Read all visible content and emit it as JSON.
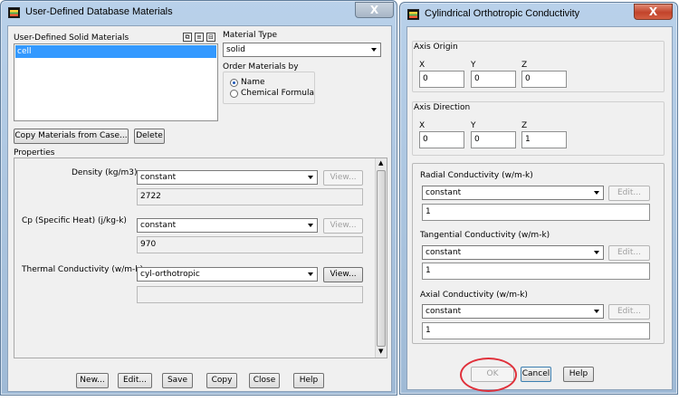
{
  "materials_window": {
    "title": "User-Defined Database Materials",
    "solid_materials_label": "User-Defined Solid Materials",
    "materials": [
      "cell"
    ],
    "copy_button": "Copy Materials from Case...",
    "delete_button": "Delete",
    "material_type_label": "Material Type",
    "material_type_value": "solid",
    "order_label": "Order Materials by",
    "order_options": [
      "Name",
      "Chemical Formula"
    ],
    "order_selected": "Name",
    "properties_label": "Properties",
    "properties": [
      {
        "label": "Density (kg/m3)",
        "method": "constant",
        "view": "View...",
        "value": "2722"
      },
      {
        "label": "Cp (Specific Heat) (j/kg-k)",
        "method": "constant",
        "view": "View...",
        "value": "970"
      },
      {
        "label": "Thermal Conductivity (w/m-k)",
        "method": "cyl-orthotropic",
        "view": "View...",
        "value": ""
      }
    ],
    "footer_buttons": [
      "New...",
      "Edit...",
      "Save",
      "Copy",
      "Close",
      "Help"
    ]
  },
  "conductivity_window": {
    "title": "Cylindrical Orthotropic Conductivity",
    "axis_origin": {
      "label": "Axis Origin",
      "x_label": "X",
      "y_label": "Y",
      "z_label": "Z",
      "x": "0",
      "y": "0",
      "z": "0"
    },
    "axis_direction": {
      "label": "Axis Direction",
      "x_label": "X",
      "y_label": "Y",
      "z_label": "Z",
      "x": "0",
      "y": "0",
      "z": "1"
    },
    "conductivities": [
      {
        "label": "Radial Conductivity (w/m-k)",
        "method": "constant",
        "edit": "Edit...",
        "value": "1"
      },
      {
        "label": "Tangential Conductivity (w/m-k)",
        "method": "constant",
        "edit": "Edit...",
        "value": "1"
      },
      {
        "label": "Axial Conductivity (w/m-k)",
        "method": "constant",
        "edit": "Edit...",
        "value": "1"
      }
    ],
    "ok_button": "OK",
    "cancel_button": "Cancel",
    "help_button": "Help"
  },
  "close_glyph": "X",
  "colors": {
    "selection": "#3399ff",
    "title_bar": "#b9d1ea",
    "close_active": "#c2432b",
    "annotation_circle": "#e0303a"
  }
}
